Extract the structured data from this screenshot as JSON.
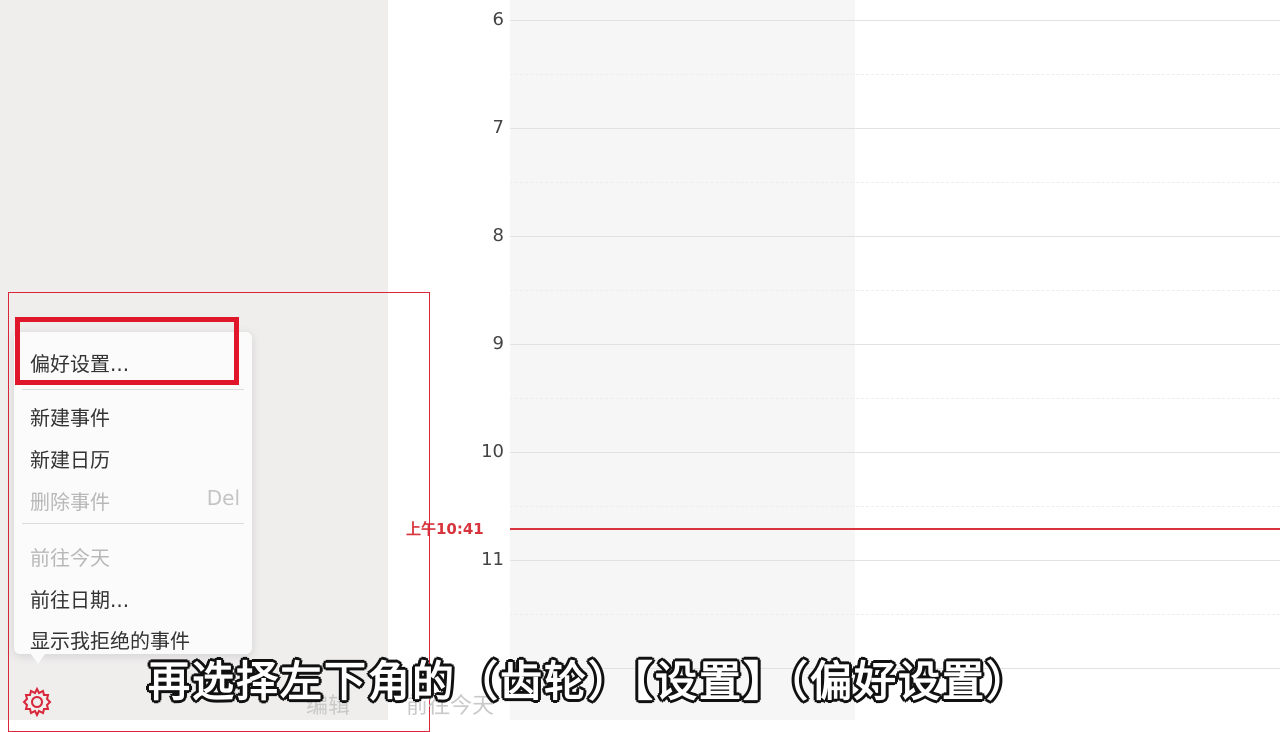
{
  "calendar": {
    "hours": [
      "6",
      "7",
      "8",
      "9",
      "10",
      "11"
    ],
    "now_label": "上午10:41",
    "accent_color": "#d8343d"
  },
  "menu": {
    "items": [
      {
        "label": "偏好设置...",
        "enabled": true
      },
      {
        "label": "新建事件",
        "enabled": true
      },
      {
        "label": "新建日历",
        "enabled": true
      },
      {
        "label": "删除事件",
        "shortcut": "Del",
        "enabled": false
      },
      {
        "label": "前往今天",
        "enabled": false
      },
      {
        "label": "前往日期...",
        "enabled": true
      },
      {
        "label": "显示我拒绝的事件",
        "enabled": true
      }
    ]
  },
  "toolbar": {
    "gear_icon": "gear-icon",
    "edit_label": "编辑",
    "today_label": "前往今天"
  },
  "caption": {
    "text": "再选择左下角的（齿轮）【设置】（偏好设置）"
  },
  "highlight_color": "#e0162b"
}
